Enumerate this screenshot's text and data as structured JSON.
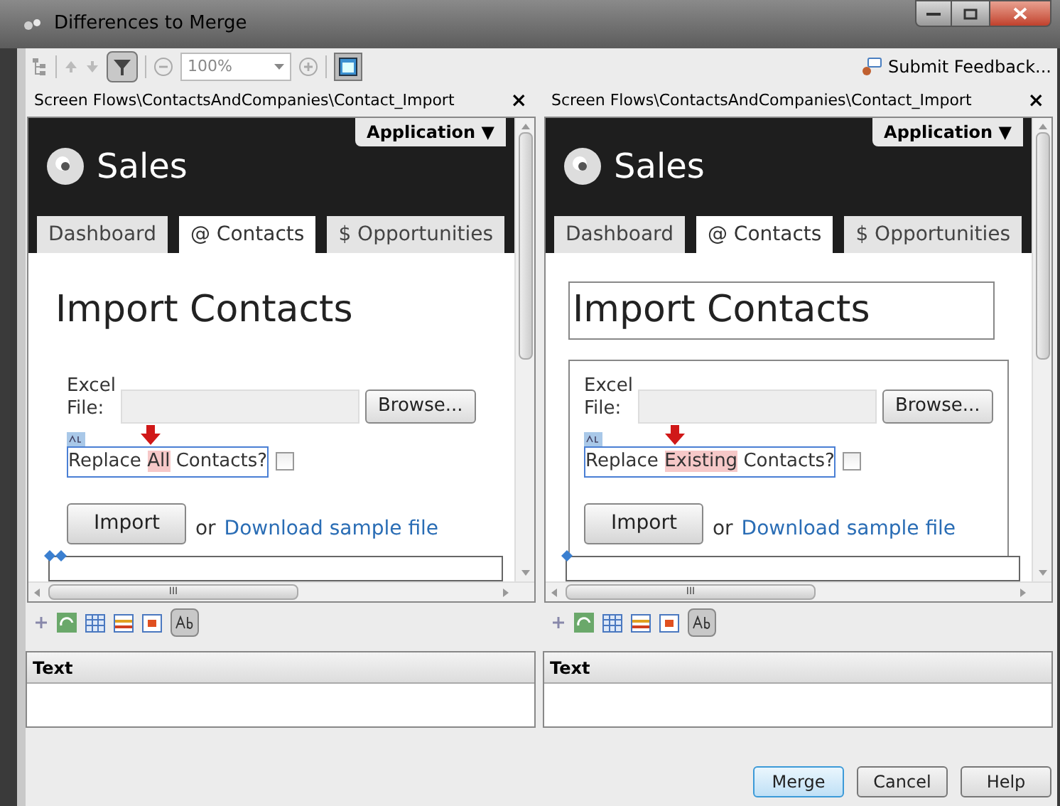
{
  "window": {
    "title": "Differences to Merge"
  },
  "toolbar": {
    "filter_on": true,
    "sync_on": true,
    "zoom": "100%",
    "feedback": "Submit Feedback..."
  },
  "panes": [
    {
      "path": "Screen Flows\\ContactsAndCompanies\\Contact_Import",
      "close": "×",
      "app_menu": "Application ▼",
      "brand": "Sales",
      "tabs": [
        {
          "label": "Dashboard",
          "selected": false
        },
        {
          "label": "@ Contacts",
          "selected": true
        },
        {
          "label": "$ Opportunities",
          "selected": false
        }
      ],
      "heading": "Import Contacts",
      "heading_boxed": false,
      "form_boxed": false,
      "file_label": "Excel File:",
      "browse": "Browse...",
      "replace_label": [
        {
          "text": "Replace ",
          "changed": false
        },
        {
          "text": "All",
          "changed": true
        },
        {
          "text": " Contacts?",
          "changed": false
        }
      ],
      "replace_checked": false,
      "import": "Import",
      "or": "or",
      "link": "Download sample file",
      "scroll_thumb": "III",
      "properties_header": "Text"
    },
    {
      "path": "Screen Flows\\ContactsAndCompanies\\Contact_Import",
      "close": "×",
      "app_menu": "Application ▼",
      "brand": "Sales",
      "tabs": [
        {
          "label": "Dashboard",
          "selected": false
        },
        {
          "label": "@ Contacts",
          "selected": true
        },
        {
          "label": "$ Opportunities",
          "selected": false
        }
      ],
      "heading": "Import Contacts",
      "heading_boxed": true,
      "form_boxed": true,
      "file_label": "Excel File:",
      "browse": "Browse...",
      "replace_label": [
        {
          "text": "Replace ",
          "changed": false
        },
        {
          "text": "Existing",
          "changed": true
        },
        {
          "text": " Contacts?",
          "changed": false
        }
      ],
      "replace_checked": false,
      "import": "Import",
      "or": "or",
      "link": "Download sample file",
      "scroll_thumb": "III",
      "properties_header": "Text"
    }
  ],
  "buttons": [
    {
      "label": "Merge",
      "default": true
    },
    {
      "label": "Cancel",
      "default": false
    },
    {
      "label": "Help",
      "default": false
    }
  ]
}
